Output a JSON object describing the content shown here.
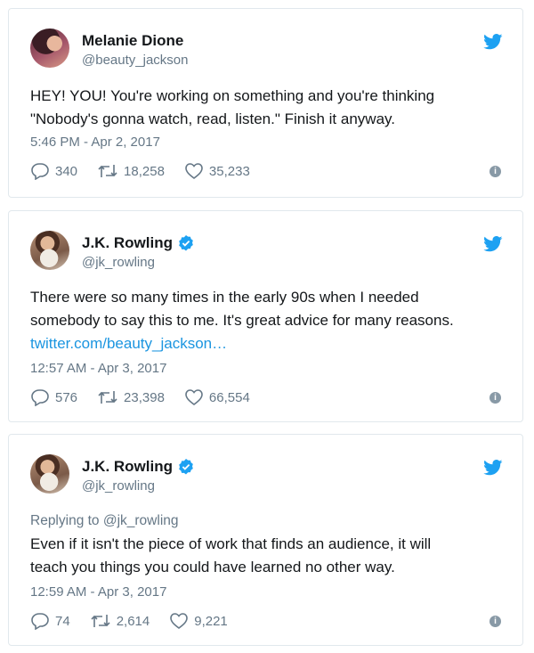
{
  "tweets": [
    {
      "display_name": "Melanie Dione",
      "handle": "@beauty_jackson",
      "verified": false,
      "text_lines": [
        "HEY! YOU! You're working on something and you're thinking",
        "\"Nobody's gonna watch, read, listen.\" Finish it anyway."
      ],
      "timestamp": "5:46 PM - Apr 2, 2017",
      "replies": "340",
      "retweets": "18,258",
      "likes": "35,233"
    },
    {
      "display_name": "J.K. Rowling",
      "handle": "@jk_rowling",
      "verified": true,
      "text_lines": [
        "There were so many times in the early 90s when I needed",
        "somebody to say this to me. It's great advice for many reasons."
      ],
      "link": "twitter.com/beauty_jackson…",
      "timestamp": "12:57 AM - Apr 3, 2017",
      "replies": "576",
      "retweets": "23,398",
      "likes": "66,554"
    },
    {
      "display_name": "J.K. Rowling",
      "handle": "@jk_rowling",
      "verified": true,
      "reply_to": "Replying to @jk_rowling",
      "text_lines": [
        "Even if it isn't the piece of work that finds an audience, it will",
        "teach you things you could have learned no other way."
      ],
      "timestamp": "12:59 AM - Apr 3, 2017",
      "replies": "74",
      "retweets": "2,614",
      "likes": "9,221"
    }
  ],
  "icons": {
    "twitter_bird": "twitter-bird-icon",
    "verified": "verified-badge-icon",
    "reply": "reply-icon",
    "retweet": "retweet-icon",
    "like": "heart-icon",
    "info": "info-icon"
  },
  "colors": {
    "twitter_blue": "#1da1f2",
    "link": "#1b95e0",
    "secondary_text": "#657786",
    "border": "#e1e8ed"
  }
}
